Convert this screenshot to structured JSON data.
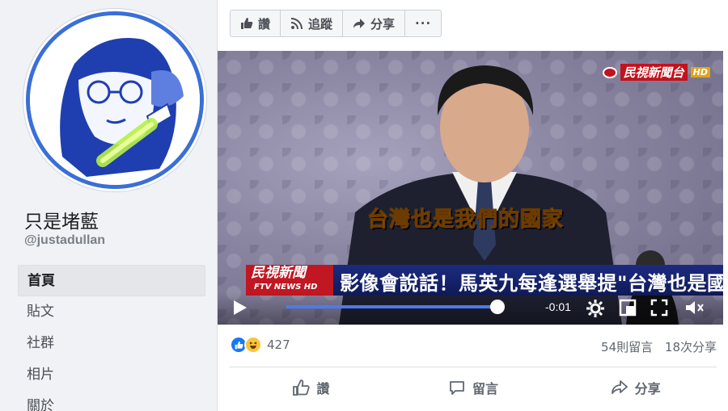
{
  "page": {
    "name": "只是堵藍",
    "handle": "@justadullan"
  },
  "nav": {
    "items": [
      {
        "label": "首頁",
        "active": true
      },
      {
        "label": "貼文",
        "active": false
      },
      {
        "label": "社群",
        "active": false
      },
      {
        "label": "相片",
        "active": false
      },
      {
        "label": "關於",
        "active": false
      }
    ]
  },
  "toolbar": {
    "like_label": "讚",
    "follow_label": "追蹤",
    "share_label": "分享",
    "more_label": "···"
  },
  "video": {
    "channel_logo": "民視新聞台",
    "hd_badge": "HD",
    "subtitle": "台灣也是我們的國家",
    "ticker_logo_main": "民視新聞",
    "ticker_logo_sub": "FTV NEWS HD",
    "ticker_text": "影像會說話！馬英九每逢選舉提\"台灣也是國家\"",
    "time_remaining": "-0:01",
    "progress": 0.97
  },
  "stats": {
    "reaction_count": "427",
    "comments": "54則留言",
    "shares": "18次分享"
  },
  "actions": {
    "like_label": "讚",
    "comment_label": "留言",
    "share_label": "分享"
  },
  "colors": {
    "accent": "#1877f2",
    "avatar_ring": "#3a6fd8"
  }
}
